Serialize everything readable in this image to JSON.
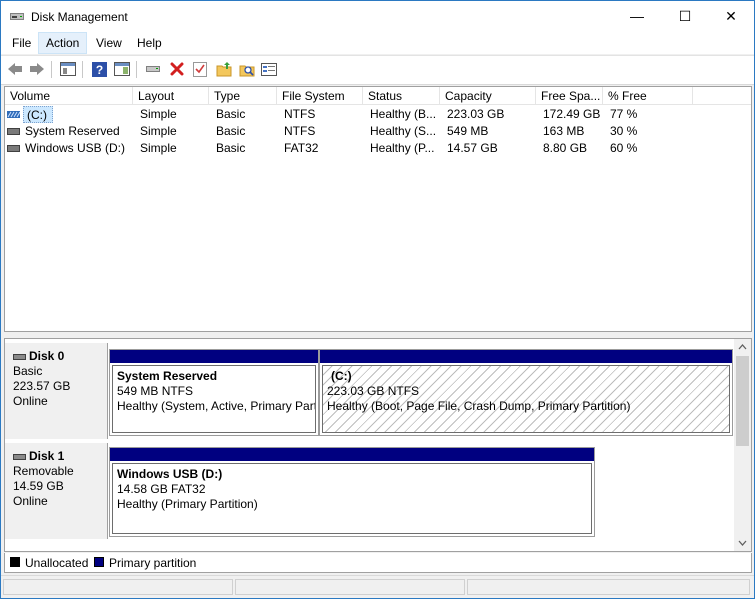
{
  "window": {
    "title": "Disk Management",
    "icon": "disk-management-icon",
    "controls": {
      "minimize": "—",
      "maximize": "☐",
      "close": "✕"
    }
  },
  "menu": [
    {
      "label": "File",
      "active": false
    },
    {
      "label": "Action",
      "active": true
    },
    {
      "label": "View",
      "active": false
    },
    {
      "label": "Help",
      "active": false
    }
  ],
  "toolbar": {
    "icons": [
      "back-arrow-icon",
      "forward-arrow-icon",
      "properties-pane-icon",
      "help-icon",
      "show-hide-pane-icon",
      "connect-disk-icon",
      "delete-icon",
      "checklist-icon",
      "open-folder-icon",
      "search-folder-icon",
      "settings-list-icon"
    ]
  },
  "volume_list": {
    "columns": [
      "Volume",
      "Layout",
      "Type",
      "File System",
      "Status",
      "Capacity",
      "Free Spa...",
      "% Free"
    ],
    "rows": [
      {
        "volume": "(C:)",
        "layout": "Simple",
        "type": "Basic",
        "fs": "NTFS",
        "status": "Healthy (B...",
        "capacity": "223.03 GB",
        "free": "172.49 GB",
        "pct": "77 %",
        "selected": true,
        "icon": "volume-striped-icon"
      },
      {
        "volume": "System Reserved",
        "layout": "Simple",
        "type": "Basic",
        "fs": "NTFS",
        "status": "Healthy (S...",
        "capacity": "549 MB",
        "free": "163 MB",
        "pct": "30 %",
        "selected": false,
        "icon": "volume-icon"
      },
      {
        "volume": "Windows USB (D:)",
        "layout": "Simple",
        "type": "Basic",
        "fs": "FAT32",
        "status": "Healthy (P...",
        "capacity": "14.57 GB",
        "free": "8.80 GB",
        "pct": "60 %",
        "selected": false,
        "icon": "volume-icon"
      }
    ]
  },
  "disks": [
    {
      "name": "Disk 0",
      "kind": "Basic",
      "size": "223.57 GB",
      "state": "Online",
      "partitions": [
        {
          "name": "System Reserved",
          "size": "549 MB NTFS",
          "status": "Healthy (System, Active, Primary Part",
          "hatched": false
        },
        {
          "name": "(C:)",
          "size": "223.03 GB NTFS",
          "status": "Healthy (Boot, Page File, Crash Dump, Primary Partition)",
          "hatched": true
        }
      ]
    },
    {
      "name": "Disk 1",
      "kind": "Removable",
      "size": "14.59 GB",
      "state": "Online",
      "partitions": [
        {
          "name": "Windows USB  (D:)",
          "size": "14.58 GB FAT32",
          "status": "Healthy (Primary Partition)",
          "hatched": false
        }
      ]
    }
  ],
  "legend": [
    {
      "label": "Unallocated",
      "color": "#000000"
    },
    {
      "label": "Primary partition",
      "color": "#000080"
    }
  ],
  "colors": {
    "accent": "#000080",
    "selection": "#cce8ff",
    "border": "#2b79c2"
  }
}
